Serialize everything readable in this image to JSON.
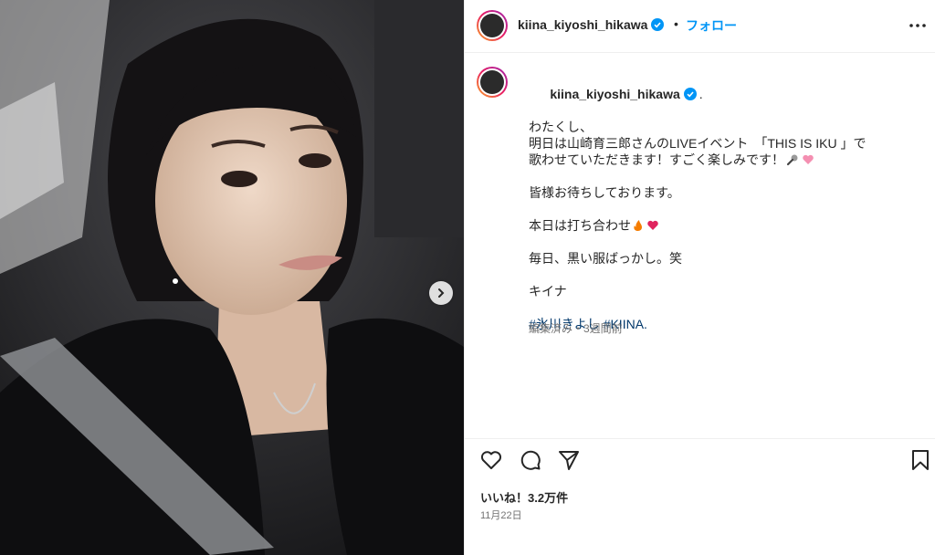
{
  "colors": {
    "accent": "#0095f6",
    "hashtag": "#00376b",
    "verified": "#0095f6",
    "heart": "#e0245e"
  },
  "header": {
    "username": "kiina_kiyoshi_hikawa",
    "separator": "•",
    "follow_label": "フォロー",
    "more_icon": "more-horizontal-icon"
  },
  "media": {
    "next_icon": "chevron-right-icon"
  },
  "caption": {
    "username": "kiina_kiyoshi_hikawa",
    "after_name": ".",
    "lines": [
      "わたくし、",
      "明日は山崎育三郎さんのLIVEイベント　「THIS IS IKU 」で",
      "歌わせていただきます！すごく楽しみです！"
    ],
    "line_wait": "皆様お待ちしております。",
    "line_rehearsal": "本日は打ち合わせ",
    "line_black": "毎日、黒い服ばっかし。笑",
    "line_sign": "キイナ",
    "hashtag_1": "#氷川きよし",
    "hashtag_2": "#KIINA.",
    "emoji_icons": [
      "microphone-icon",
      "pink-heart-icon",
      "fire-icon",
      "red-heart-icon"
    ],
    "meta": "編集済み・3週間前"
  },
  "actions": {
    "icons": [
      "heart-outline-icon",
      "comment-icon",
      "share-icon",
      "bookmark-icon"
    ],
    "likes": "いいね！3.2万件",
    "date": "11月22日"
  }
}
